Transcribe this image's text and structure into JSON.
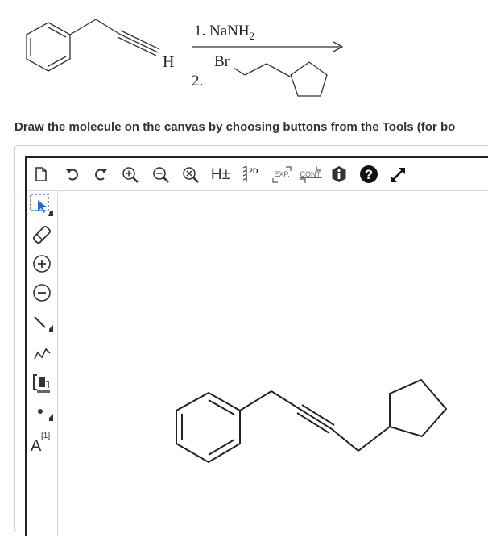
{
  "reaction": {
    "reactant_atom": "H",
    "step1": "1. NaNH",
    "step1_sub": "2",
    "step2": "2.",
    "step2_atom": "Br"
  },
  "instruction": "Draw the molecule on the canvas by choosing buttons from the Tools (for bo",
  "toolbar": {
    "hydrogen_label": "H±",
    "twod_label": "2D",
    "expand_label": "EXP.",
    "contract_label": "CONT."
  },
  "sidebar": {
    "atom_label": "A",
    "atom_index": "[1]"
  }
}
